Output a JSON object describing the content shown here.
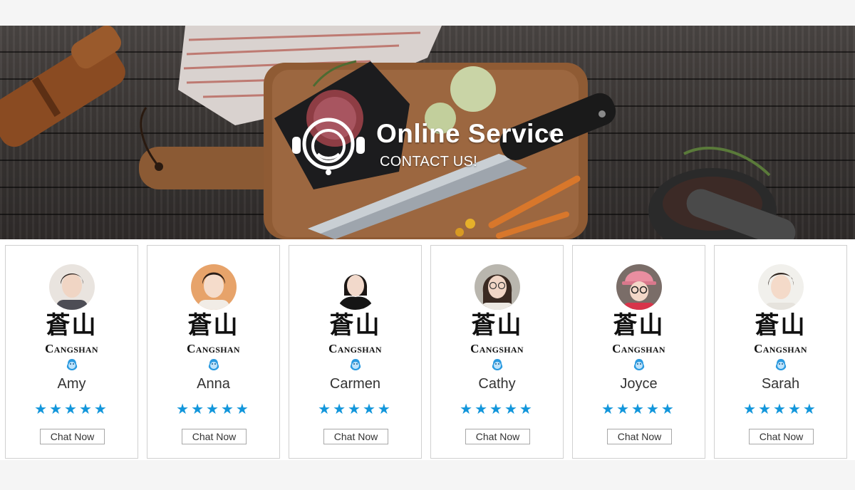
{
  "banner": {
    "title": "Online Service",
    "subtitle": "CONTACT US!",
    "icon": "headset-icon"
  },
  "brand": {
    "cn": "蒼山",
    "en": "Cangshan"
  },
  "colors": {
    "star": "#1296db",
    "qq": "#2a9ae0",
    "border": "#d0d0d0"
  },
  "agents": [
    {
      "name": "Amy",
      "rating": 5,
      "chat_label": "Chat Now",
      "avatar_bg": "#e9e4df"
    },
    {
      "name": "Anna",
      "rating": 5,
      "chat_label": "Chat Now",
      "avatar_bg": "#e7a36a"
    },
    {
      "name": "Carmen",
      "rating": 5,
      "chat_label": "Chat Now",
      "avatar_bg": "#ffffff"
    },
    {
      "name": "Cathy",
      "rating": 5,
      "chat_label": "Chat Now",
      "avatar_bg": "#b9b6ae"
    },
    {
      "name": "Joyce",
      "rating": 5,
      "chat_label": "Chat Now",
      "avatar_bg": "#7a6d68"
    },
    {
      "name": "Sarah",
      "rating": 5,
      "chat_label": "Chat Now",
      "avatar_bg": "#f1f0ec"
    }
  ]
}
